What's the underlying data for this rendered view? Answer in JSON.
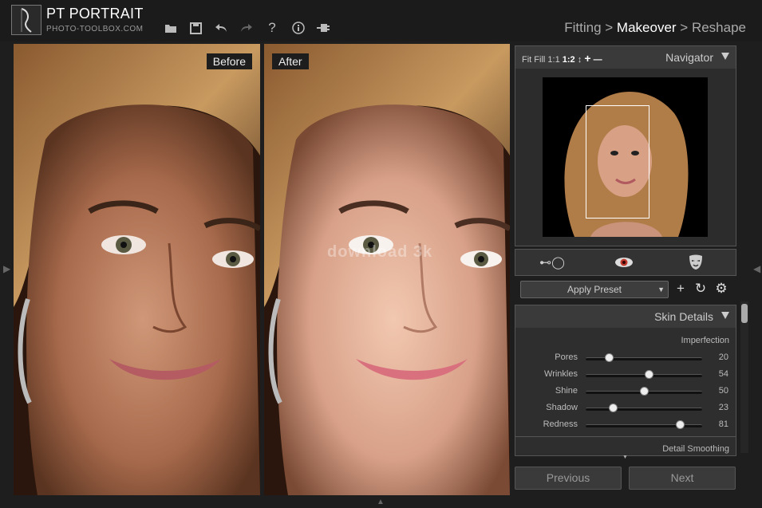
{
  "app": {
    "title": "PT PORTRAIT",
    "subtitle": "PHOTO-TOOLBOX.COM"
  },
  "toolbar": {
    "icons": [
      "folder-icon",
      "save-icon",
      "undo-icon",
      "redo-icon",
      "help-icon",
      "info-icon",
      "plugin-icon"
    ],
    "glyphs": [
      "▬",
      "▣",
      "↶",
      "↷",
      "?",
      "ⓘ",
      "⊣"
    ]
  },
  "steps": {
    "fitting": "Fitting",
    "sep1": " > ",
    "makeover": "Makeover",
    "sep2": " > ",
    "reshape": "Reshape"
  },
  "panes": {
    "before_label": "Before",
    "after_label": "After"
  },
  "watermark": "download 3k",
  "navigator": {
    "zoom_fit": "Fit",
    "zoom_fill": "Fill",
    "zoom_1_1": "1:1",
    "zoom_current": "1:2",
    "zoom_stepper": "↕",
    "zoom_in": "+",
    "zoom_out": "—",
    "title": "Navigator"
  },
  "modes": {
    "left_glyph": "⊷◯",
    "eye_glyph": "◉",
    "mask_glyph": "☗"
  },
  "preset": {
    "label": "Apply Preset",
    "add": "+",
    "refresh": "↻",
    "settings": "⚙"
  },
  "skin": {
    "title": "Skin Details",
    "section1": "Imperfection",
    "section2": "Detail Smoothing",
    "sliders": [
      {
        "label": "Pores",
        "value": 20
      },
      {
        "label": "Wrinkles",
        "value": 54
      },
      {
        "label": "Shine",
        "value": 50
      },
      {
        "label": "Shadow",
        "value": 23
      },
      {
        "label": "Redness",
        "value": 81
      }
    ]
  },
  "buttons": {
    "previous": "Previous",
    "next": "Next"
  },
  "colors": {
    "accent_eye": "#c0392b",
    "panel_bg": "#2e2e2e"
  }
}
